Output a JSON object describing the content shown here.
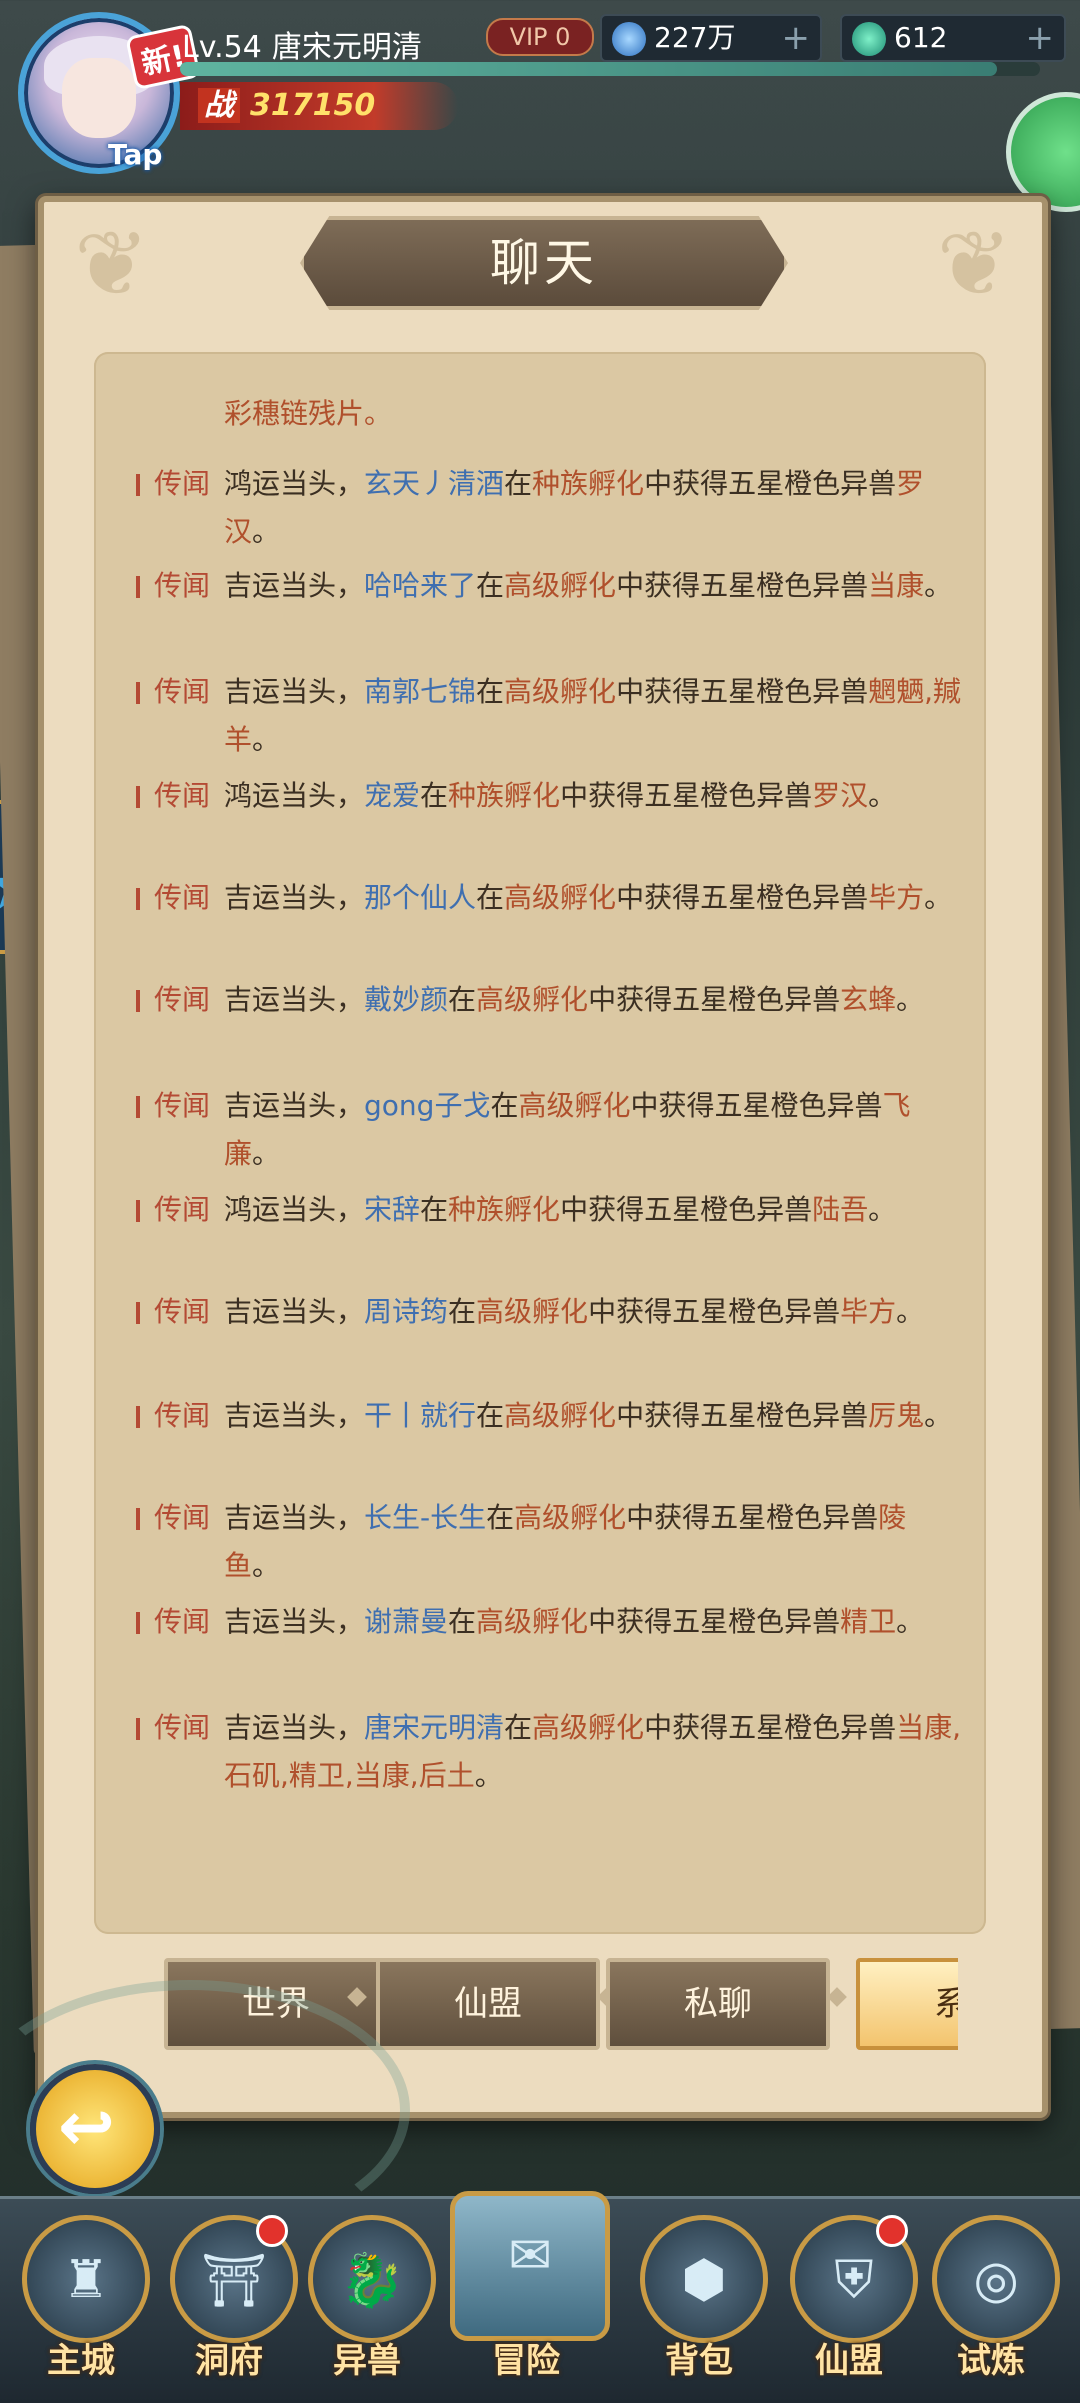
{
  "hud": {
    "new_label": "新!",
    "tap_label": "Tap",
    "level": "Lv.54",
    "player_name": "唐宋元明清",
    "vip": "VIP 0",
    "currency1": "227万",
    "currency2": "612",
    "power_prefix": "战",
    "power": "317150",
    "plus": "+"
  },
  "panel": {
    "title": "聊天"
  },
  "chat": {
    "tag": "传闻",
    "first_fragment": "彩穗链残片。",
    "messages": [
      {
        "luck": "鸿运当头，",
        "player": "玄天丿清酒",
        "mid1": "在",
        "place": "种族孵化",
        "mid2": "中获得五星橙色异兽",
        "beast": "罗汉",
        "tail": "。"
      },
      {
        "luck": "吉运当头，",
        "player": "哈哈来了",
        "mid1": "在",
        "place": "高级孵化",
        "mid2": "中获得五星橙色异兽",
        "beast": "当康",
        "tail": "。"
      },
      {
        "luck": "吉运当头，",
        "player": "南郭七锦",
        "mid1": "在",
        "place": "高级孵化",
        "mid2": "中获得五星橙色异兽",
        "beast": "魍魉,羬羊",
        "tail": "。"
      },
      {
        "luck": "鸿运当头，",
        "player": "宠爱",
        "mid1": "在",
        "place": "种族孵化",
        "mid2": "中获得五星橙色异兽",
        "beast": "罗汉",
        "tail": "。"
      },
      {
        "luck": "吉运当头，",
        "player": "那个仙人",
        "mid1": "在",
        "place": "高级孵化",
        "mid2": "中获得五星橙色异兽",
        "beast": "毕方",
        "tail": "。"
      },
      {
        "luck": "吉运当头，",
        "player": "戴妙颜",
        "mid1": "在",
        "place": "高级孵化",
        "mid2": "中获得五星橙色异兽",
        "beast": "玄蜂",
        "tail": "。"
      },
      {
        "luck": "吉运当头，",
        "player": "gong子戈",
        "mid1": "在",
        "place": "高级孵化",
        "mid2": "中获得五星橙色异兽",
        "beast": "飞廉",
        "tail": "。"
      },
      {
        "luck": "鸿运当头，",
        "player": "宋辞",
        "mid1": "在",
        "place": "种族孵化",
        "mid2": "中获得五星橙色异兽",
        "beast": "陆吾",
        "tail": "。"
      },
      {
        "luck": "吉运当头，",
        "player": "周诗筠",
        "mid1": "在",
        "place": "高级孵化",
        "mid2": "中获得五星橙色异兽",
        "beast": "毕方",
        "tail": "。"
      },
      {
        "luck": "吉运当头，",
        "player": "干丨就行",
        "mid1": "在",
        "place": "高级孵化",
        "mid2": "中获得五星橙色异兽",
        "beast": "厉鬼",
        "tail": "。"
      },
      {
        "luck": "吉运当头，",
        "player": "长生-长生",
        "mid1": "在",
        "place": "高级孵化",
        "mid2": "中获得五星橙色异兽",
        "beast": "陵鱼",
        "tail": "。"
      },
      {
        "luck": "吉运当头，",
        "player": "谢萧曼",
        "mid1": "在",
        "place": "高级孵化",
        "mid2": "中获得五星橙色异兽",
        "beast": "精卫",
        "tail": "。"
      },
      {
        "luck": "吉运当头，",
        "player": "唐宋元明清",
        "mid1": "在",
        "place": "高级孵化",
        "mid2": "中获得五星橙色异兽",
        "beast": "当康,石矶,精卫,当康,后土",
        "tail": "。"
      }
    ]
  },
  "tabs": [
    "世界",
    "仙盟",
    "私聊",
    "系统"
  ],
  "active_tab": 3,
  "nav": [
    {
      "label": "主城",
      "icon": "city-icon",
      "dot": false
    },
    {
      "label": "洞府",
      "icon": "cave-icon",
      "dot": true
    },
    {
      "label": "异兽",
      "icon": "beast-icon",
      "dot": false
    },
    {
      "label": "冒险",
      "icon": "scroll-map-icon",
      "dot": false
    },
    {
      "label": "背包",
      "icon": "bag-icon",
      "dot": false
    },
    {
      "label": "仙盟",
      "icon": "alliance-icon",
      "dot": true
    },
    {
      "label": "试炼",
      "icon": "trial-icon",
      "dot": false
    }
  ],
  "colors": {
    "player": "#3f6fb0",
    "highlight": "#b0502c",
    "tag": "#b44a34",
    "paper": "#ecdcbf"
  }
}
